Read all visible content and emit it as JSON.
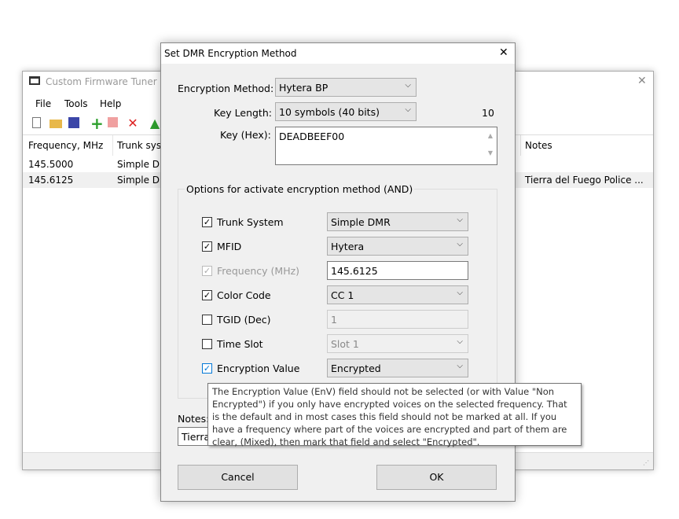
{
  "main_window": {
    "title": "Custom Firmware Tuner : D:",
    "menu": [
      "File",
      "Tools",
      "Help"
    ],
    "toolbar": [
      "new-file-icon",
      "open-folder-icon",
      "save-icon",
      "add-icon",
      "copy-icon",
      "delete-icon",
      "move-up-icon"
    ],
    "columns": [
      "Frequency, MHz",
      "Trunk syst",
      "Notes"
    ],
    "rows": [
      {
        "frequency": "145.5000",
        "trunk": "Simple DM",
        "notes": ""
      },
      {
        "frequency": "145.6125",
        "trunk": "Simple DM",
        "notes": "Tierra del Fuego Police ..."
      }
    ],
    "close_glyph": "✕"
  },
  "dialog": {
    "title": "Set DMR Encryption Method",
    "close_glyph": "✕",
    "encryption_method_label": "Encryption Method:",
    "encryption_method": "Hytera BP",
    "key_length_label": "Key Length:",
    "key_length": "10 symbols (40 bits)",
    "key_length_count": "10",
    "key_label": "Key (Hex):",
    "key": "DEADBEEF00",
    "group_title": "Options for activate encryption method (AND)",
    "options": [
      {
        "label": "Trunk System",
        "checked": true,
        "enabled": true,
        "value": "Simple DMR",
        "control": "combo"
      },
      {
        "label": "MFID",
        "checked": true,
        "enabled": true,
        "value": "Hytera",
        "control": "combo"
      },
      {
        "label": "Frequency (MHz)",
        "checked": true,
        "enabled": false,
        "value": "145.6125",
        "control": "text"
      },
      {
        "label": "Color Code",
        "checked": true,
        "enabled": true,
        "value": "CC 1",
        "control": "combo"
      },
      {
        "label": "TGID (Dec)",
        "checked": false,
        "enabled": true,
        "value": "1",
        "control": "text-disabled"
      },
      {
        "label": "Time Slot",
        "checked": false,
        "enabled": true,
        "value": "Slot 1",
        "control": "combo-disabled"
      },
      {
        "label": "Encryption Value",
        "checked": true,
        "enabled": true,
        "value": "Encrypted",
        "control": "combo"
      }
    ],
    "notes_label": "Notes:",
    "notes_value": "Tierra",
    "cancel": "Cancel",
    "ok": "OK"
  },
  "tooltip": "The Encryption Value (EnV) field should not be selected (or with Value \"Non Encrypted\") if you only have encrypted voices on the selected frequency. That is the default and in most cases this field should not be marked at all. If you have a frequency where part of the voices are encrypted and part of them are clear, (Mixed), then mark that field and select \"Encrypted\"."
}
